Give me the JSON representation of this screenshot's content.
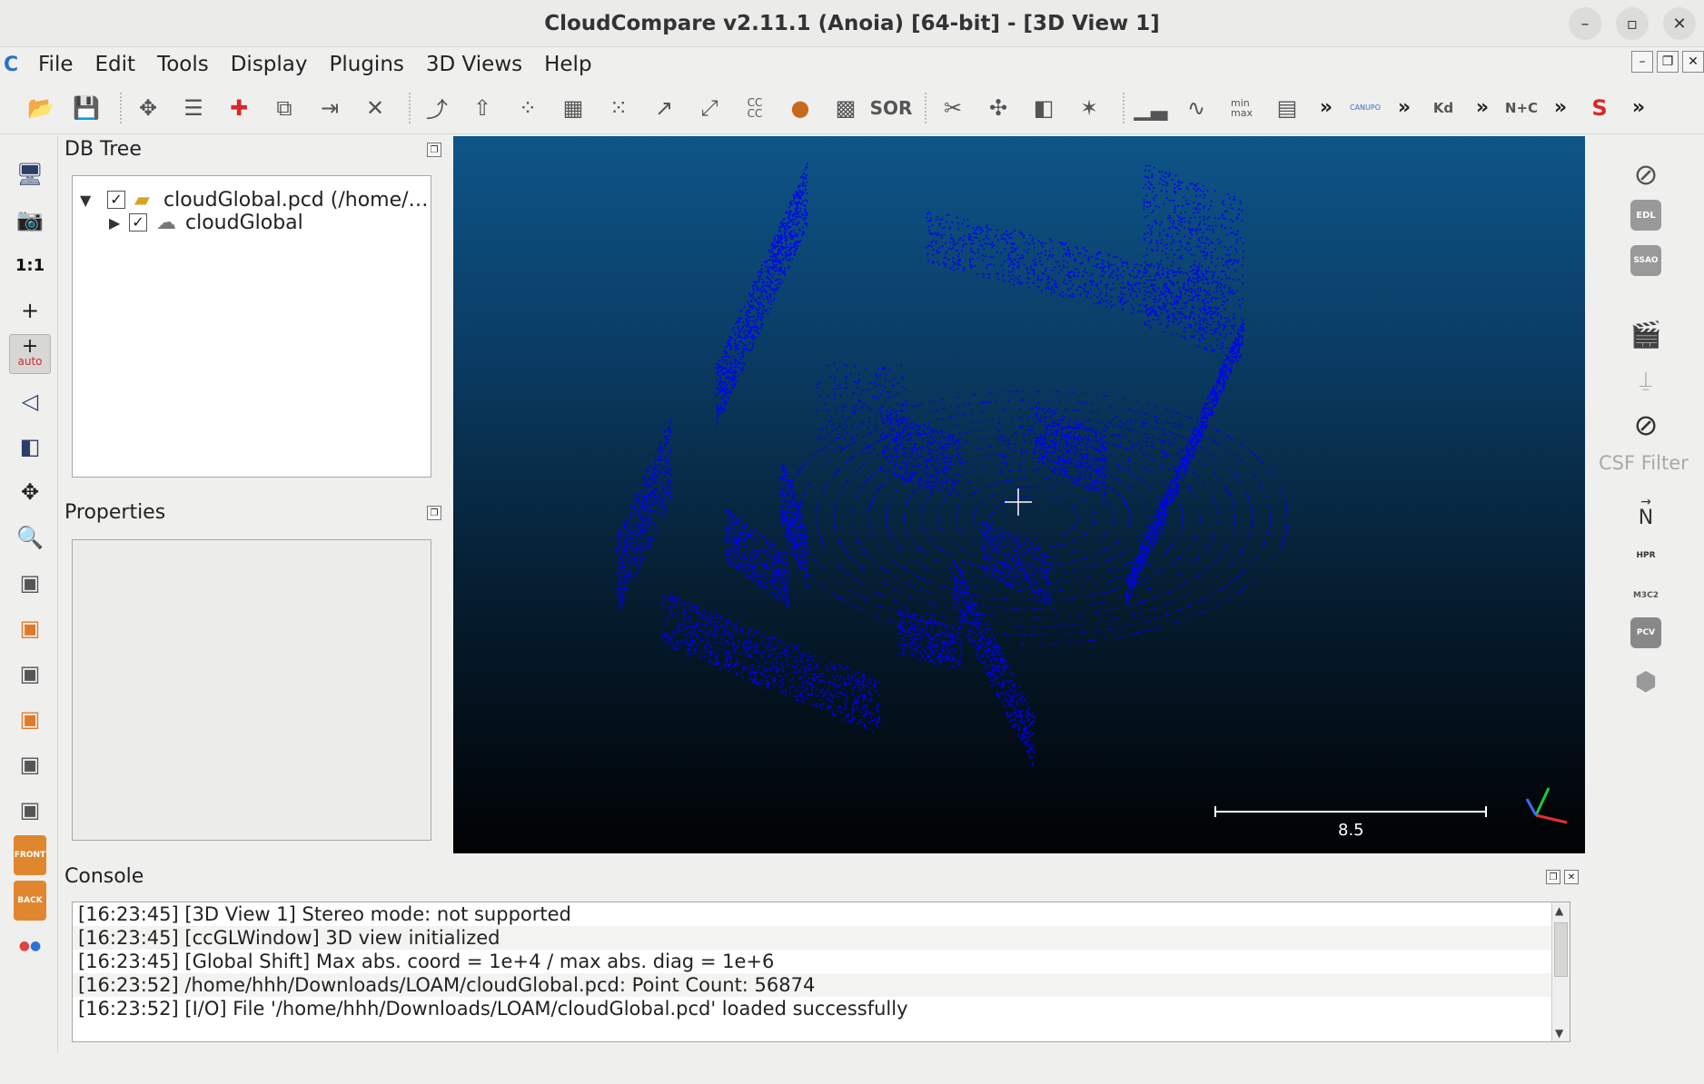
{
  "window": {
    "title": "CloudCompare v2.11.1 (Anoia) [64-bit] - [3D View 1]",
    "controls": [
      "minimize",
      "maximize",
      "close"
    ]
  },
  "menubar": {
    "items": [
      "File",
      "Edit",
      "Tools",
      "Display",
      "Plugins",
      "3D Views",
      "Help"
    ]
  },
  "toolbar": {
    "text_icons": {
      "cc": "CC\nCC",
      "sor": "SOR",
      "minmax": "min\nmax",
      "canupo": "CANUPO",
      "kd": "Kd",
      "nc": "N+C"
    },
    "more": "»"
  },
  "left_toolbar": {
    "one_to_one": "1:1",
    "auto": "auto",
    "front": "FRONT",
    "back": "BACK"
  },
  "dbtree": {
    "title": "DB Tree",
    "items": [
      {
        "label": "cloudGlobal.pcd (/home/…",
        "checked": true,
        "expanded": true
      },
      {
        "label": "cloudGlobal",
        "checked": true,
        "expanded": false
      }
    ]
  },
  "properties": {
    "title": "Properties"
  },
  "view3d": {
    "scale_value": "8.5",
    "point_color": "#0000ff"
  },
  "right_toolbar": {
    "csf_label": "CSF Filter",
    "north_label": "N",
    "text_icons": {
      "edl": "EDL",
      "ssao": "SSAO",
      "hpr": "HPR",
      "m3c2": "M3C2",
      "pcv": "PCV"
    }
  },
  "console": {
    "title": "Console",
    "lines": [
      "[16:23:45] [3D View 1] Stereo mode: not supported",
      "[16:23:45] [ccGLWindow] 3D view initialized",
      "[16:23:45] [Global Shift] Max abs. coord = 1e+4 / max abs. diag = 1e+6",
      "[16:23:52] /home/hhh/Downloads/LOAM/cloudGlobal.pcd: Point Count: 56874",
      "[16:23:52] [I/O] File '/home/hhh/Downloads/LOAM/cloudGlobal.pcd' loaded successfully"
    ]
  }
}
